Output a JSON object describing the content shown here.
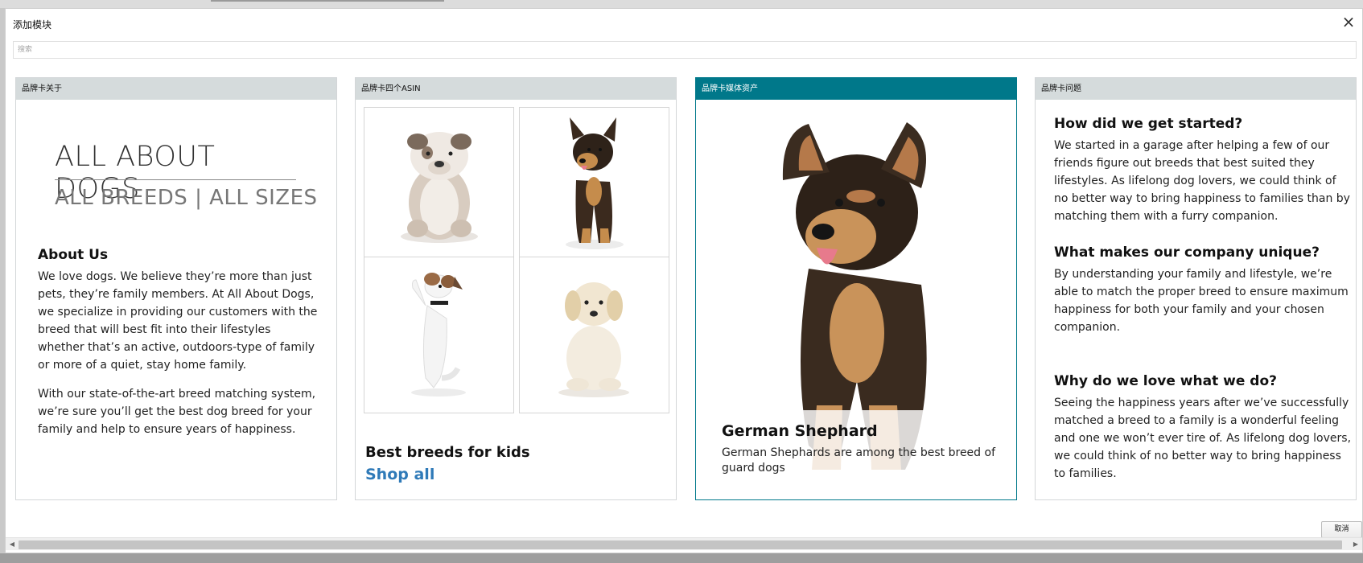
{
  "dialog": {
    "title": "添加模块",
    "close_label": "×",
    "search_placeholder": "搜索",
    "cancel_label": "取消"
  },
  "cards": [
    {
      "header": "品牌卡关于",
      "selected": false,
      "title": "ALL ABOUT DOGS",
      "subtitle": "ALL BREEDS | ALL SIZES",
      "section_heading": "About Us",
      "paragraph_1": "We love dogs. We believe they’re more than just pets, they’re family members. At All About Dogs, we specialize in providing our customers with the breed that will best fit into their lifestyles whether that’s an active, outdoors-type of family or more of a quiet, stay home family.",
      "paragraph_2": "With our state-of-the-art breed matching system, we’re sure you’ll get the best dog breed for your family and help to ensure years of happiness."
    },
    {
      "header": "品牌卡四个ASIN",
      "selected": false,
      "heading": "Best breeds for kids",
      "link": "Shop all",
      "tiles": [
        "bulldog-image",
        "german-shepherd-puppy-image",
        "jack-russell-image",
        "golden-puppy-image"
      ]
    },
    {
      "header": "品牌卡媒体资产",
      "selected": true,
      "heading": "German Shephard",
      "body": "German Shephards are among the best breed of guard dogs"
    },
    {
      "header": "品牌卡问题",
      "selected": false,
      "q1": "How did we get started?",
      "a1": "We started in a garage after helping a few of our friends figure out breeds that best suited they lifestyles. As lifelong dog lovers, we could think of no better way to bring happiness to families than by matching them with a furry companion.",
      "q2": "What makes our company unique?",
      "a2": "By understanding your family and lifestyle, we’re able to match the proper breed to ensure maximum happiness for both your family and your chosen companion.",
      "q3": "Why do we love what we do?",
      "a3": "Seeing the happiness years after we’ve successfully matched a breed to a family is a wonderful feeling and one we won’t ever tire of. As lifelong dog lovers, we could think of no better way to bring happiness to families."
    }
  ],
  "colors": {
    "accent": "#00788a",
    "link": "#2f7ab8",
    "header_bg": "#d5dbdc"
  },
  "icons": {
    "close": "close-icon",
    "scroll_left": "scroll-left-arrow-icon",
    "scroll_right": "scroll-right-arrow-icon"
  }
}
